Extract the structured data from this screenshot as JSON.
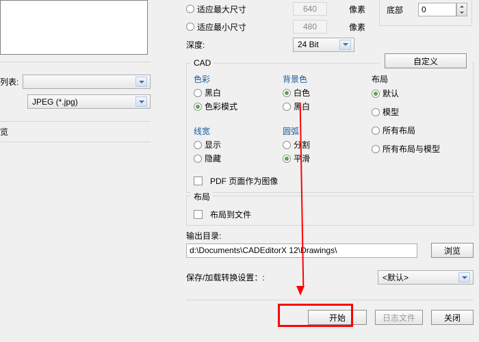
{
  "left": {
    "list_label": "列表:",
    "format_selected": "JPEG (*.jpg)",
    "preview_label": "览"
  },
  "size": {
    "fitmax_label": "适应最大尺寸",
    "fitmax_value": "640",
    "fitmin_label": "适应最小尺寸",
    "fitmin_value": "480",
    "pixel_unit": "像素",
    "depth_label": "深度:",
    "depth_value": "24 Bit"
  },
  "margin": {
    "bottom_label": "底部",
    "bottom_value": "0",
    "custom_btn": "自定义"
  },
  "cad": {
    "group_title": "CAD",
    "color": {
      "title": "色彩",
      "bw": "黑白",
      "colormode": "色彩模式"
    },
    "bg": {
      "title": "背景色",
      "white": "白色",
      "black": "黑白"
    },
    "layout": {
      "title": "布局",
      "default": "默认",
      "model": "模型",
      "all": "所有布局",
      "all_model": "所有布局与模型"
    },
    "lw": {
      "title": "线宽",
      "show": "显示",
      "hide": "隐藏"
    },
    "arc": {
      "title": "圆弧",
      "split": "分割",
      "smooth": "平滑"
    },
    "pdf_as_image": "PDF 页面作为图像"
  },
  "layout_out": {
    "group_title": "布局",
    "to_file": "布局到文件"
  },
  "output": {
    "label": "输出目录:",
    "path": "d:\\Documents\\CADEditorX 12\\Drawings\\",
    "browse": "浏览"
  },
  "settings": {
    "label": "保存/加载转换设置：:",
    "value": "<默认>"
  },
  "footer": {
    "start": "开始",
    "log": "日志文件",
    "close": "关闭"
  }
}
